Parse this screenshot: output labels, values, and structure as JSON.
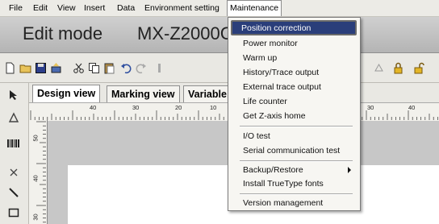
{
  "menubar": {
    "items": [
      "File",
      "Edit",
      "View",
      "Insert",
      "Data",
      "Environment setting",
      "Maintenance"
    ]
  },
  "title": {
    "mode": "Edit mode",
    "model": "MX-Z2000C"
  },
  "tabs": [
    "Design view",
    "Marking view",
    "Variable"
  ],
  "ruler": {
    "h_labels": [
      "40",
      "30",
      "20",
      "10",
      "30",
      "40"
    ],
    "v_labels": [
      "50",
      "40",
      "30"
    ]
  },
  "maintenance_menu": {
    "items": [
      "Position correction",
      "Power monitor",
      "Warm up",
      "History/Trace output",
      "External trace output",
      "Life counter",
      "Get Z-axis home",
      "I/O test",
      "Serial communication test",
      "Backup/Restore",
      "Install TrueType fonts",
      "Version management"
    ],
    "highlighted": "Position correction"
  },
  "colors": {
    "highlight": "#2a3e7a",
    "menu_bg": "#f7f6f2",
    "title_bg": "#c2c2c2"
  }
}
